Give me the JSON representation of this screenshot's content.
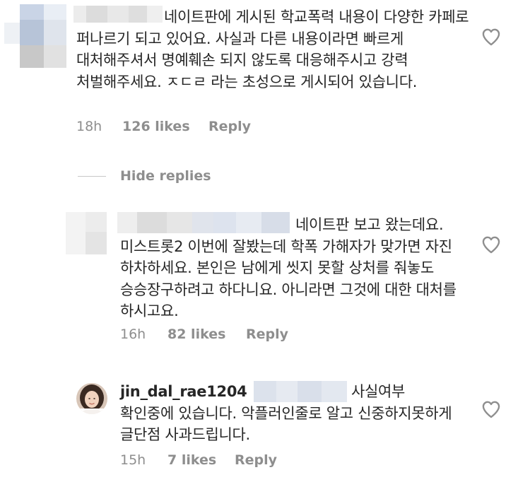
{
  "comments": [
    {
      "text": "네이트판에 게시된 학교폭력 내용이 다양한 카페로 퍼나르기 되고 있어요. 사실과 다른 내용이라면 빠르게 대처해주셔서 명예훼손 되지 않도록 대응해주시고 강력 처벌해주세요. ㅈㄷㄹ 라는 초성으로 게시되어 있습니다.",
      "time": "18h",
      "likes": "126 likes",
      "reply": "Reply"
    },
    {
      "text": "네이트판 보고 왔는데요. 미스트롯2 이번에 잘봤는데 학폭 가해자가 맞가면 자진 하차하세요. 본인은 남에게 씻지 못할 상처를 줘놓도 승승장구하려고 하다니요. 아니라면 그것에 대한 대처를 하시고요.",
      "time": "16h",
      "likes": "82 likes",
      "reply": "Reply"
    },
    {
      "username": "jin_dal_rae1204",
      "text": "사실여부 확인중에 있습니다. 악플러인줄로 알고 신중하지못하게 글단점 사과드립니다.",
      "time": "15h",
      "likes": "7 likes",
      "reply": "Reply"
    }
  ],
  "hide_replies": "Hide replies",
  "icons": {
    "like": "heart-outline-icon",
    "avatar": "profile-photo"
  },
  "colors": {
    "text": "#262626",
    "meta": "#8e8e8e",
    "divider": "#c7c7c7"
  }
}
